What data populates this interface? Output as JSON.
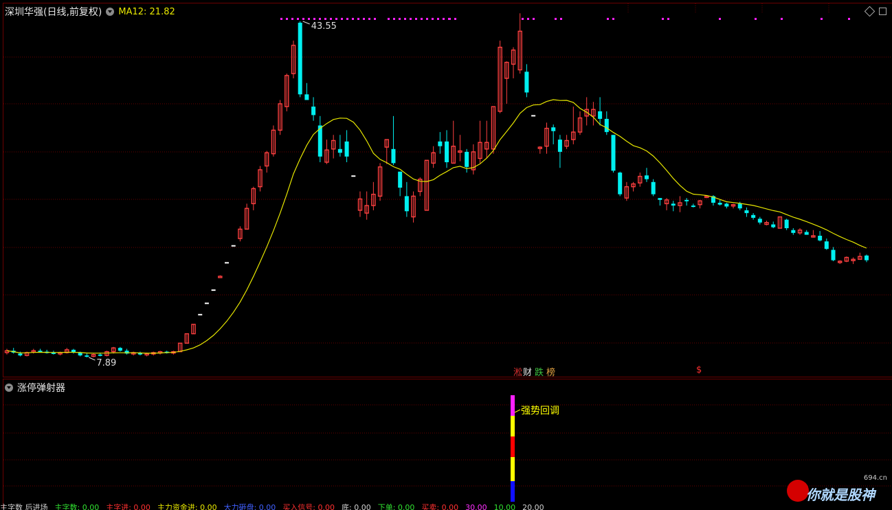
{
  "main": {
    "stock_title": "深圳华强(日线,前复权)",
    "ma_label": "MA12: 21.82",
    "high_label": "43.55",
    "low_label": "7.89",
    "badges": [
      {
        "text": "淞",
        "color": "#e03030"
      },
      {
        "text": "财",
        "color": "#e8e8e8"
      },
      {
        "text": "跌",
        "color": "#3ec040"
      },
      {
        "text": "榜",
        "color": "#e0a040"
      },
      {
        "text": "$",
        "color": "#ff3030"
      }
    ]
  },
  "sub": {
    "title": "涨停弹射器",
    "annotation": "强势回调",
    "colors": {
      "magenta": "#ff20ff",
      "yellow": "#ffff00",
      "red": "#ff0000",
      "blue": "#1010ff"
    }
  },
  "bottom_bar": {
    "items": [
      {
        "text": "主字数 后进场",
        "color": "#d0d0d0"
      },
      {
        "text": "主字数: 0.00",
        "color": "#30e030"
      },
      {
        "text": "主字进: 0.00",
        "color": "#ff3030"
      },
      {
        "text": "主力资金进: 0.00",
        "color": "#e8e800"
      },
      {
        "text": "大力砸盘: 0.00",
        "color": "#4060ff"
      },
      {
        "text": "买入信号: 0.00",
        "color": "#ff3030"
      },
      {
        "text": "底: 0.00",
        "color": "#d0d0d0"
      },
      {
        "text": "下单: 0.00",
        "color": "#30e030"
      },
      {
        "text": "买卖: 0.00",
        "color": "#ff3030"
      },
      {
        "text": "30.00",
        "color": "#ff30ff"
      },
      {
        "text": "10.00",
        "color": "#30e030"
      },
      {
        "text": "20.00",
        "color": "#d0d0d0"
      }
    ]
  },
  "logo": {
    "site": "694.cn",
    "text": "你就是股神"
  },
  "colors": {
    "up": "#ff4040",
    "down": "#00f0f0",
    "ma": "#e8e800",
    "grid": "#6b0000",
    "marker": "#ff20ff",
    "flat": "#ffffff"
  },
  "chart_data": {
    "type": "candlestick",
    "title": "深圳华强(日线,前复权)",
    "indicator": "MA12",
    "ma_last": 21.82,
    "ylim": [
      7,
      45
    ],
    "grid": true,
    "annotations": [
      {
        "text": "43.55",
        "kind": "high"
      },
      {
        "text": "7.89",
        "kind": "low"
      }
    ],
    "candles": [
      [
        8.4,
        8.8,
        8.2,
        8.6
      ],
      [
        8.6,
        8.9,
        8.3,
        8.4
      ],
      [
        8.3,
        8.5,
        8.0,
        8.1
      ],
      [
        8.1,
        8.5,
        8.0,
        8.4
      ],
      [
        8.5,
        8.8,
        8.3,
        8.6
      ],
      [
        8.6,
        8.8,
        8.4,
        8.5
      ],
      [
        8.5,
        8.7,
        8.3,
        8.4
      ],
      [
        8.4,
        8.6,
        8.2,
        8.3
      ],
      [
        8.3,
        8.5,
        8.1,
        8.4
      ],
      [
        8.4,
        8.9,
        8.3,
        8.7
      ],
      [
        8.7,
        8.8,
        8.3,
        8.4
      ],
      [
        8.4,
        8.5,
        8.0,
        8.1
      ],
      [
        8.1,
        8.3,
        7.89,
        8.0
      ],
      [
        8.0,
        8.3,
        7.9,
        8.2
      ],
      [
        8.2,
        8.4,
        8.0,
        8.1
      ],
      [
        8.1,
        8.6,
        8.0,
        8.5
      ],
      [
        8.5,
        9.0,
        8.3,
        8.9
      ],
      [
        8.9,
        9.0,
        8.5,
        8.6
      ],
      [
        8.6,
        8.8,
        8.2,
        8.3
      ],
      [
        8.3,
        8.5,
        8.1,
        8.4
      ],
      [
        8.4,
        8.5,
        8.1,
        8.2
      ],
      [
        8.2,
        8.4,
        8.0,
        8.3
      ],
      [
        8.3,
        8.5,
        8.1,
        8.4
      ],
      [
        8.4,
        8.6,
        8.2,
        8.5
      ],
      [
        8.5,
        8.6,
        8.3,
        8.4
      ],
      [
        8.4,
        8.6,
        8.2,
        8.5
      ],
      [
        8.5,
        9.4,
        8.5,
        9.4
      ],
      [
        9.4,
        10.4,
        9.4,
        10.4
      ],
      [
        10.4,
        11.4,
        10.4,
        11.4
      ],
      [
        12.5,
        12.5,
        12.5,
        12.5
      ],
      [
        13.7,
        13.7,
        13.7,
        13.7
      ],
      [
        15.1,
        15.1,
        15.1,
        15.1
      ],
      [
        16.4,
        16.6,
        16.4,
        16.5
      ],
      [
        18.0,
        18.0,
        18.0,
        18.0
      ],
      [
        19.8,
        19.8,
        19.8,
        19.8
      ],
      [
        20.5,
        21.8,
        20.2,
        21.5
      ],
      [
        21.5,
        24.2,
        21.5,
        23.7
      ],
      [
        24.2,
        26.0,
        23.5,
        25.8
      ],
      [
        26.0,
        28.2,
        25.5,
        27.8
      ],
      [
        28.2,
        29.8,
        27.5,
        29.6
      ],
      [
        29.5,
        32.5,
        29.2,
        32.0
      ],
      [
        32.0,
        35.2,
        31.5,
        34.8
      ],
      [
        34.5,
        38.0,
        34.0,
        37.8
      ],
      [
        38.0,
        41.5,
        37.5,
        41.0
      ],
      [
        43.4,
        43.55,
        35.5,
        35.8
      ],
      [
        35.8,
        37.0,
        35.2,
        35.2
      ],
      [
        34.5,
        35.5,
        33.0,
        33.6
      ],
      [
        32.5,
        33.5,
        28.6,
        29.2
      ],
      [
        28.6,
        31.0,
        28.4,
        29.9
      ],
      [
        30.0,
        31.5,
        29.0,
        30.9
      ],
      [
        30.0,
        31.5,
        29.2,
        29.6
      ],
      [
        30.8,
        32.0,
        28.6,
        29.2
      ],
      [
        27.2,
        27.2,
        27.2,
        27.2
      ],
      [
        23.5,
        25.5,
        22.8,
        24.7
      ],
      [
        23.2,
        25.5,
        22.5,
        24.0
      ],
      [
        24.0,
        26.5,
        23.5,
        25.2
      ],
      [
        25.0,
        28.5,
        24.5,
        28.1
      ],
      [
        30.2,
        31.0,
        28.4,
        31.0
      ],
      [
        30.0,
        33.5,
        28.3,
        28.5
      ],
      [
        27.6,
        27.6,
        25.0,
        25.9
      ],
      [
        25.0,
        26.5,
        22.8,
        23.4
      ],
      [
        22.8,
        25.5,
        22.2,
        25.0
      ],
      [
        25.5,
        27.0,
        25.0,
        26.8
      ],
      [
        23.5,
        28.8,
        23.5,
        28.8
      ],
      [
        28.5,
        30.3,
        28.0,
        29.6
      ],
      [
        30.8,
        31.8,
        29.5,
        30.3
      ],
      [
        30.8,
        32.0,
        28.0,
        28.6
      ],
      [
        28.5,
        33.0,
        28.5,
        30.3
      ],
      [
        29.8,
        31.5,
        28.7,
        29.8
      ],
      [
        29.7,
        30.0,
        27.5,
        28.1
      ],
      [
        27.8,
        30.5,
        27.3,
        29.7
      ],
      [
        29.0,
        33.0,
        28.5,
        30.7
      ],
      [
        30.0,
        33.0,
        29.0,
        30.7
      ],
      [
        30.0,
        34.5,
        29.5,
        34.5
      ],
      [
        34.0,
        41.5,
        33.8,
        40.8
      ],
      [
        37.5,
        39.3,
        34.8,
        39.2
      ],
      [
        39.0,
        40.8,
        37.5,
        40.5
      ],
      [
        38.4,
        44.4,
        38.0,
        42.5
      ],
      [
        38.2,
        39.0,
        35.5,
        36.0
      ],
      [
        33.6,
        33.6,
        33.6,
        33.6
      ],
      [
        30.1,
        30.3,
        29.5,
        30.2
      ],
      [
        30.3,
        32.8,
        29.5,
        32.2
      ],
      [
        32.3,
        32.6,
        30.5,
        31.9
      ],
      [
        31.0,
        31.5,
        28.0,
        29.7
      ],
      [
        30.3,
        31.5,
        30.0,
        30.9
      ],
      [
        31.0,
        34.5,
        30.5,
        31.8
      ],
      [
        31.8,
        34.0,
        31.5,
        33.3
      ],
      [
        33.5,
        35.5,
        32.5,
        34.2
      ],
      [
        33.5,
        35.0,
        32.5,
        34.2
      ],
      [
        34.0,
        35.5,
        32.5,
        33.2
      ],
      [
        33.2,
        34.0,
        31.5,
        31.8
      ],
      [
        31.5,
        31.5,
        27.5,
        27.7
      ],
      [
        27.5,
        27.6,
        25.0,
        25.2
      ],
      [
        24.8,
        26.5,
        24.5,
        26.0
      ],
      [
        26.0,
        26.5,
        25.5,
        26.3
      ],
      [
        26.4,
        27.5,
        26.0,
        27.1
      ],
      [
        27.2,
        28.0,
        26.5,
        26.8
      ],
      [
        26.5,
        26.8,
        25.0,
        25.2
      ],
      [
        24.8,
        24.8,
        24.0,
        24.6
      ],
      [
        24.2,
        24.8,
        23.5,
        24.6
      ],
      [
        24.2,
        24.5,
        23.4,
        24.0
      ],
      [
        24.0,
        25.0,
        23.3,
        24.3
      ],
      [
        24.6,
        24.8,
        24.0,
        24.5
      ],
      [
        24.0,
        24.2,
        23.8,
        23.9
      ],
      [
        24.1,
        24.6,
        23.7,
        24.5
      ],
      [
        24.9,
        25.1,
        24.8,
        25.0
      ],
      [
        25.0,
        25.1,
        24.0,
        24.3
      ],
      [
        24.3,
        24.6,
        24.0,
        24.1
      ],
      [
        24.2,
        24.3,
        23.7,
        23.9
      ],
      [
        24.0,
        24.2,
        23.7,
        24.1
      ],
      [
        24.2,
        24.4,
        23.5,
        23.7
      ],
      [
        23.5,
        23.8,
        22.8,
        23.2
      ],
      [
        23.0,
        23.2,
        22.5,
        22.7
      ],
      [
        22.6,
        22.8,
        22.0,
        22.2
      ],
      [
        22.0,
        22.4,
        21.9,
        22.2
      ],
      [
        22.0,
        22.3,
        21.6,
        21.7
      ],
      [
        21.6,
        22.8,
        21.6,
        22.8
      ],
      [
        22.5,
        22.6,
        21.4,
        21.6
      ],
      [
        21.4,
        21.6,
        20.9,
        21.1
      ],
      [
        21.1,
        21.6,
        20.9,
        21.4
      ],
      [
        21.2,
        21.4,
        20.9,
        20.9
      ],
      [
        20.8,
        21.4,
        20.6,
        20.8
      ],
      [
        20.8,
        21.3,
        20.2,
        20.3
      ],
      [
        20.2,
        20.5,
        19.3,
        19.4
      ],
      [
        19.3,
        19.6,
        18.1,
        18.2
      ],
      [
        18.0,
        18.2,
        17.8,
        18.1
      ],
      [
        18.1,
        18.6,
        18.0,
        18.5
      ],
      [
        18.2,
        18.5,
        17.8,
        18.3
      ],
      [
        18.3,
        19.0,
        18.3,
        18.6
      ],
      [
        18.7,
        18.8,
        18.0,
        18.2
      ]
    ]
  }
}
